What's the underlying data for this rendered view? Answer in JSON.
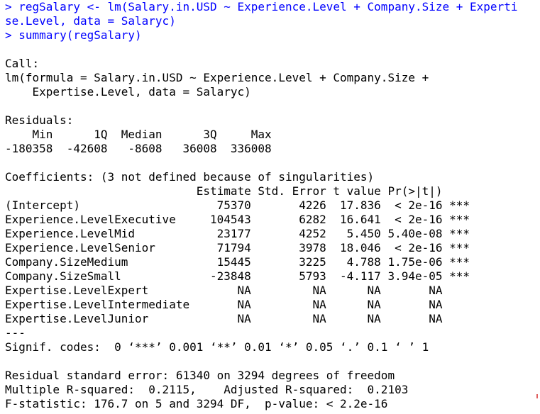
{
  "console": {
    "commands": [
      "> regSalary <- lm(Salary.in.USD ~ Experience.Level + Company.Size + Experti",
      "se.Level, data = Salaryc)",
      "> summary(regSalary)"
    ],
    "call_header": "Call:",
    "call_lines": [
      "lm(formula = Salary.in.USD ~ Experience.Level + Company.Size +",
      "    Expertise.Level, data = Salaryc)"
    ],
    "residuals_header": "Residuals:",
    "residuals_lines": [
      "    Min      1Q  Median      3Q     Max ",
      "-180358  -42608   -8608   36008  336008 "
    ],
    "coefficients_header": "Coefficients: (3 not defined because of singularities)",
    "coef_table_header": "                            Estimate Std. Error t value Pr(>|t|)    ",
    "coef_rows": [
      "(Intercept)                    75370       4226  17.836  < 2e-16 ***",
      "Experience.LevelExecutive     104543       6282  16.641  < 2e-16 ***",
      "Experience.LevelMid            23177       4252   5.450 5.40e-08 ***",
      "Experience.LevelSenior         71794       3978  18.046  < 2e-16 ***",
      "Company.SizeMedium             15445       3225   4.788 1.75e-06 ***",
      "Company.SizeSmall             -23848       5793  -4.117 3.94e-05 ***",
      "Expertise.LevelExpert             NA         NA      NA       NA    ",
      "Expertise.LevelIntermediate       NA         NA      NA       NA    ",
      "Expertise.LevelJunior             NA         NA      NA       NA    "
    ],
    "separator": "---",
    "signif_codes": "Signif. codes:  0 ‘***’ 0.001 ‘**’ 0.01 ‘*’ 0.05 ‘.’ 0.1 ‘ ’ 1",
    "footer_lines": [
      "Residual standard error: 61340 on 3294 degrees of freedom",
      "Multiple R-squared:  0.2115,\tAdjusted R-squared:  0.2103 ",
      "F-statistic: 176.7 on 5 and 3294 DF,  p-value: < 2.2e-16"
    ]
  },
  "colors": {
    "command_text": "#0000ff",
    "output_text": "#000000",
    "background": "#ffffff"
  }
}
